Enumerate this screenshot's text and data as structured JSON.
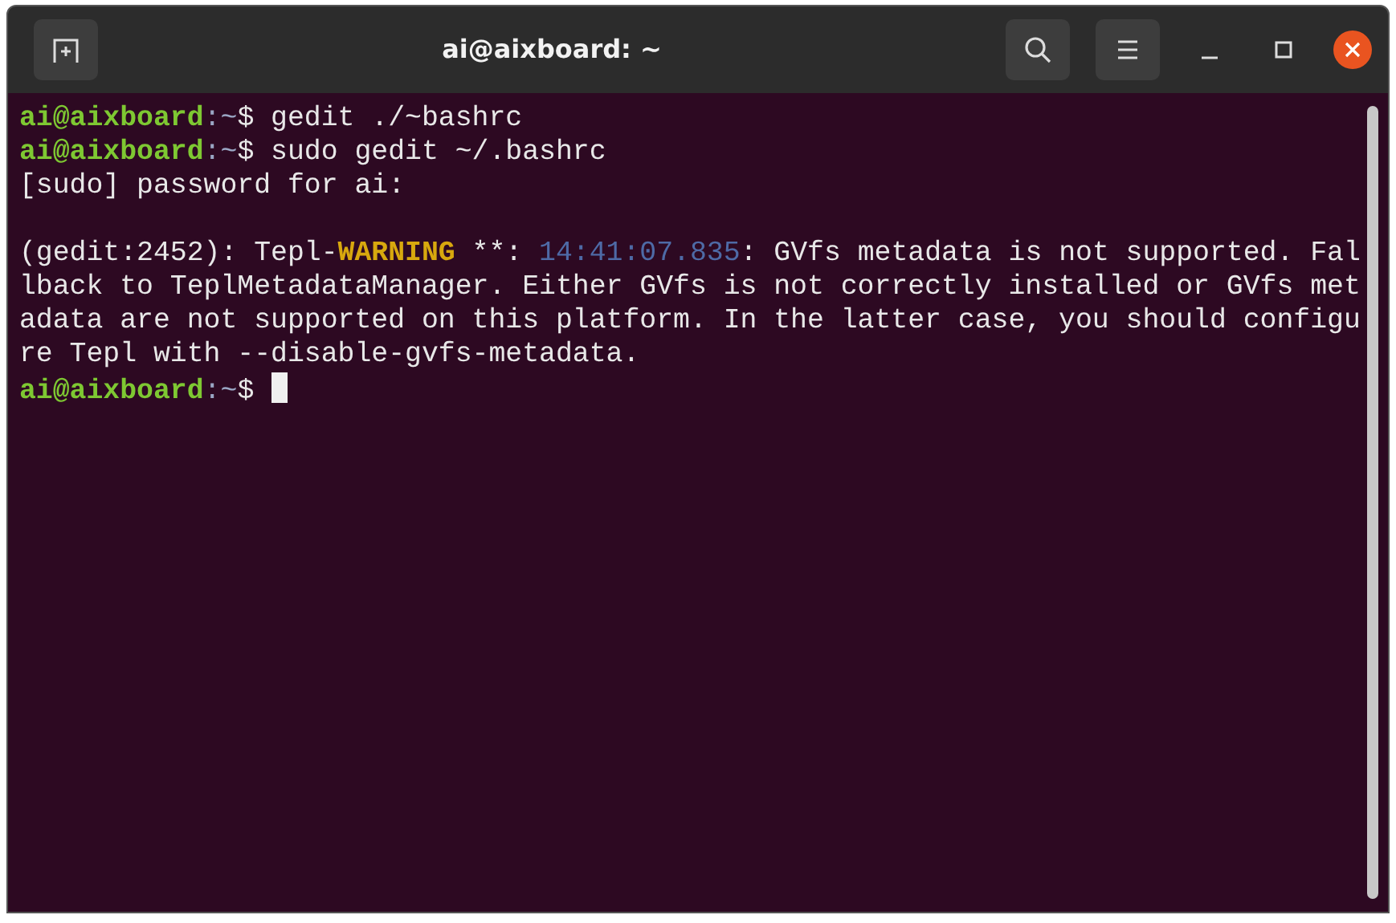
{
  "window": {
    "title": "ai@aixboard: ~"
  },
  "terminal": {
    "lines": [
      {
        "kind": "text",
        "cursor": false,
        "segments": [
          {
            "kind": "user",
            "text": "ai@aixboard"
          },
          {
            "kind": "path",
            "text": ":~"
          },
          {
            "kind": "plain",
            "text": "$ gedit ./~bashrc"
          }
        ]
      },
      {
        "kind": "text",
        "cursor": false,
        "segments": [
          {
            "kind": "user",
            "text": "ai@aixboard"
          },
          {
            "kind": "path",
            "text": ":~"
          },
          {
            "kind": "plain",
            "text": "$ sudo gedit ~/.bashrc"
          }
        ]
      },
      {
        "kind": "text",
        "cursor": false,
        "segments": [
          {
            "kind": "plain",
            "text": "[sudo] password for ai:"
          }
        ]
      },
      {
        "kind": "blank",
        "cursor": false
      },
      {
        "kind": "text",
        "cursor": false,
        "segments": [
          {
            "kind": "plain",
            "text": "(gedit:2452): Tepl-"
          },
          {
            "kind": "warning",
            "text": "WARNING"
          },
          {
            "kind": "plain",
            "text": " **: "
          },
          {
            "kind": "timestamp",
            "text": "14:41:07.835"
          },
          {
            "kind": "plain",
            "text": ": GVfs metadata is not supported. Fal"
          }
        ]
      },
      {
        "kind": "text",
        "cursor": false,
        "segments": [
          {
            "kind": "plain",
            "text": "lback to TeplMetadataManager. Either GVfs is not correctly installed or GVfs met"
          }
        ]
      },
      {
        "kind": "text",
        "cursor": false,
        "segments": [
          {
            "kind": "plain",
            "text": "adata are not supported on this platform. In the latter case, you should configu"
          }
        ]
      },
      {
        "kind": "text",
        "cursor": false,
        "segments": [
          {
            "kind": "plain",
            "text": "re Tepl with --disable-gvfs-metadata."
          }
        ]
      },
      {
        "kind": "text",
        "cursor": true,
        "segments": [
          {
            "kind": "user",
            "text": "ai@aixboard"
          },
          {
            "kind": "path",
            "text": ":~"
          },
          {
            "kind": "plain",
            "text": "$ "
          }
        ]
      }
    ]
  }
}
